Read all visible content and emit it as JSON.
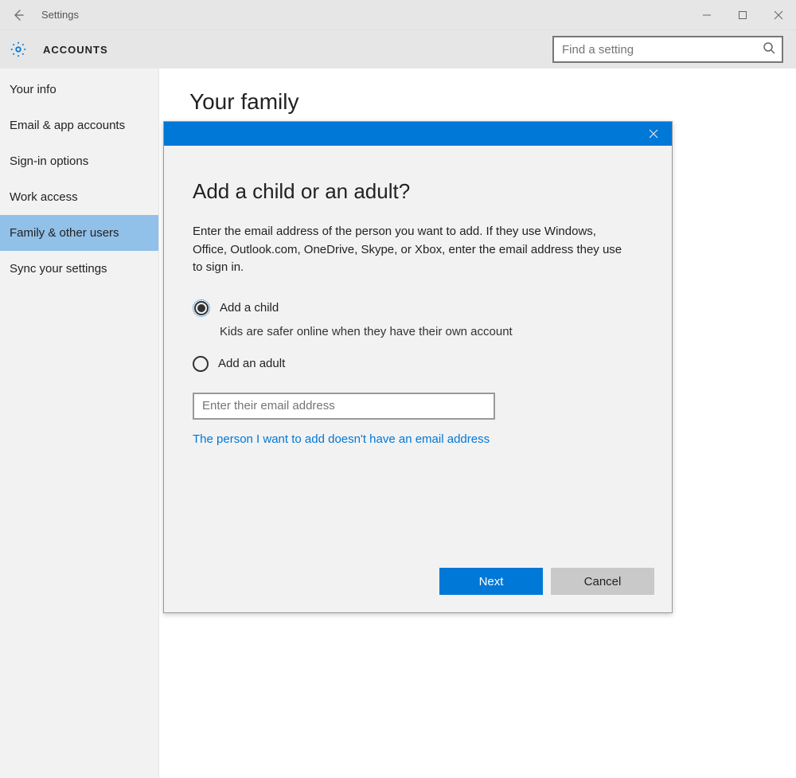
{
  "window": {
    "title": "Settings"
  },
  "header": {
    "section": "ACCOUNTS",
    "search_placeholder": "Find a setting"
  },
  "sidebar": {
    "items": [
      {
        "label": "Your info"
      },
      {
        "label": "Email & app accounts"
      },
      {
        "label": "Sign-in options"
      },
      {
        "label": "Work access"
      },
      {
        "label": "Family & other users"
      },
      {
        "label": "Sync your settings"
      }
    ],
    "selected_index": 4
  },
  "main": {
    "heading": "Your family"
  },
  "dialog": {
    "title": "Add a child or an adult?",
    "description": "Enter the email address of the person you want to add. If they use Windows, Office, Outlook.com, OneDrive, Skype, or Xbox, enter the email address they use to sign in.",
    "options": {
      "child": {
        "label": "Add a child",
        "sublabel": "Kids are safer online when they have their own account",
        "selected": true
      },
      "adult": {
        "label": "Add an adult",
        "selected": false
      }
    },
    "email_placeholder": "Enter their email address",
    "no_email_link": "The person I want to add doesn't have an email address",
    "buttons": {
      "next": "Next",
      "cancel": "Cancel"
    }
  }
}
